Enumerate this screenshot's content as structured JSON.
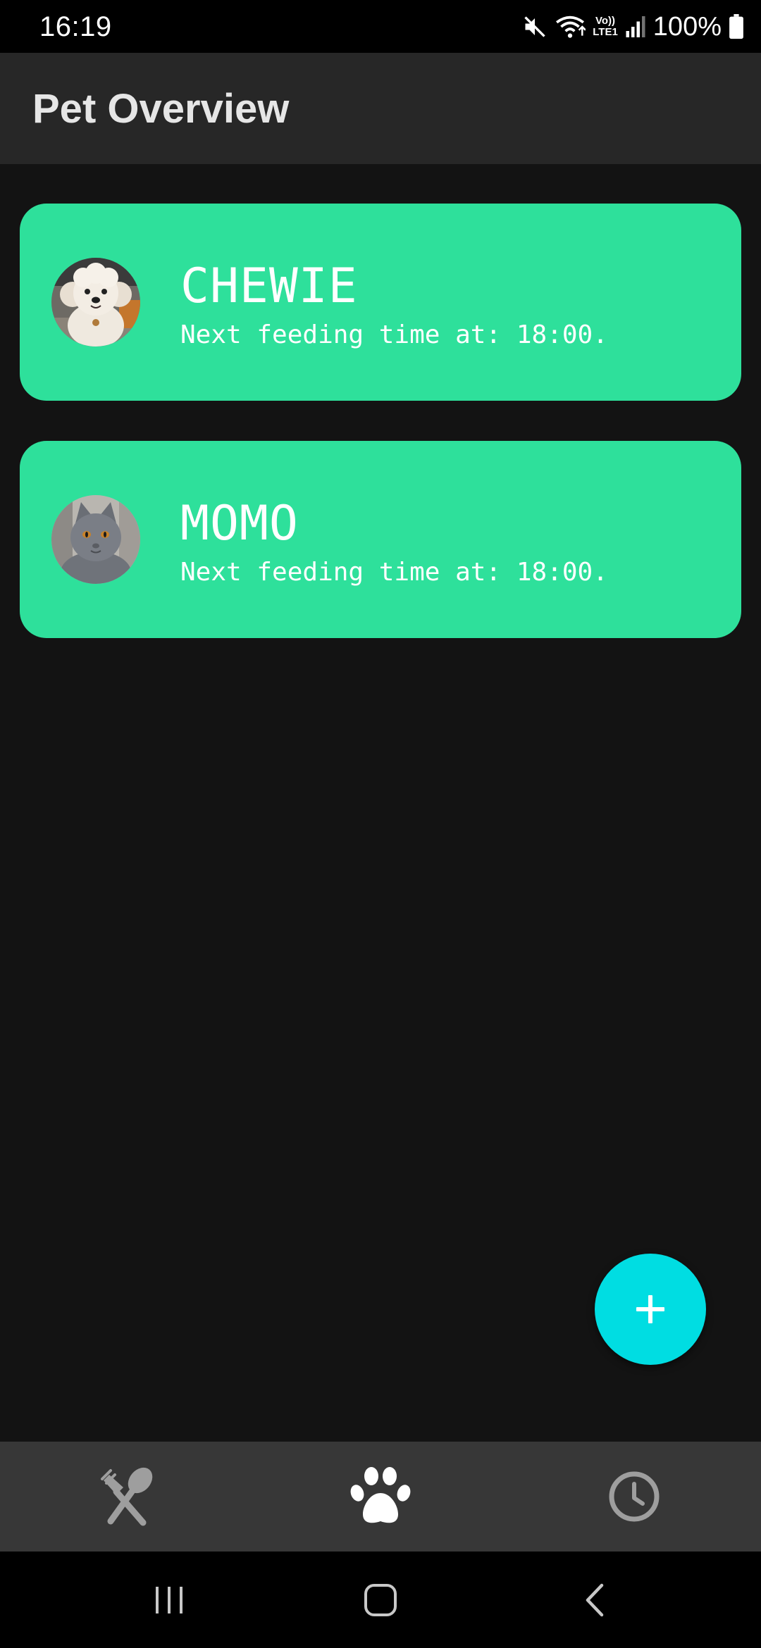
{
  "status_bar": {
    "time": "16:19",
    "battery_text": "100%",
    "lte_top": "Vo))",
    "lte_bottom": "LTE1",
    "icons": [
      "mute-icon",
      "wifi-icon",
      "volte-icon",
      "signal-icon",
      "battery-icon"
    ]
  },
  "app_bar": {
    "title": "Pet Overview"
  },
  "pets": [
    {
      "name": "CHEWIE",
      "feeding": "Next feeding time at: 18:00.",
      "avatar": "dog-photo"
    },
    {
      "name": "MOMO",
      "feeding": "Next feeding time at: 18:00.",
      "avatar": "cat-photo"
    }
  ],
  "fab": {
    "icon": "plus-icon"
  },
  "bottom_nav": {
    "items": [
      {
        "icon": "fork-spoon-icon",
        "active": false
      },
      {
        "icon": "paw-icon",
        "active": true
      },
      {
        "icon": "clock-icon",
        "active": false
      }
    ]
  },
  "system_nav": {
    "items": [
      "recents-icon",
      "home-icon",
      "back-icon"
    ]
  },
  "colors": {
    "background": "#131313",
    "app_bar": "#272727",
    "card": "#2ee09b",
    "fab": "#00dde2",
    "bottom_nav": "#373737",
    "nav_inactive": "#9e9e9e",
    "nav_active": "#ffffff"
  }
}
